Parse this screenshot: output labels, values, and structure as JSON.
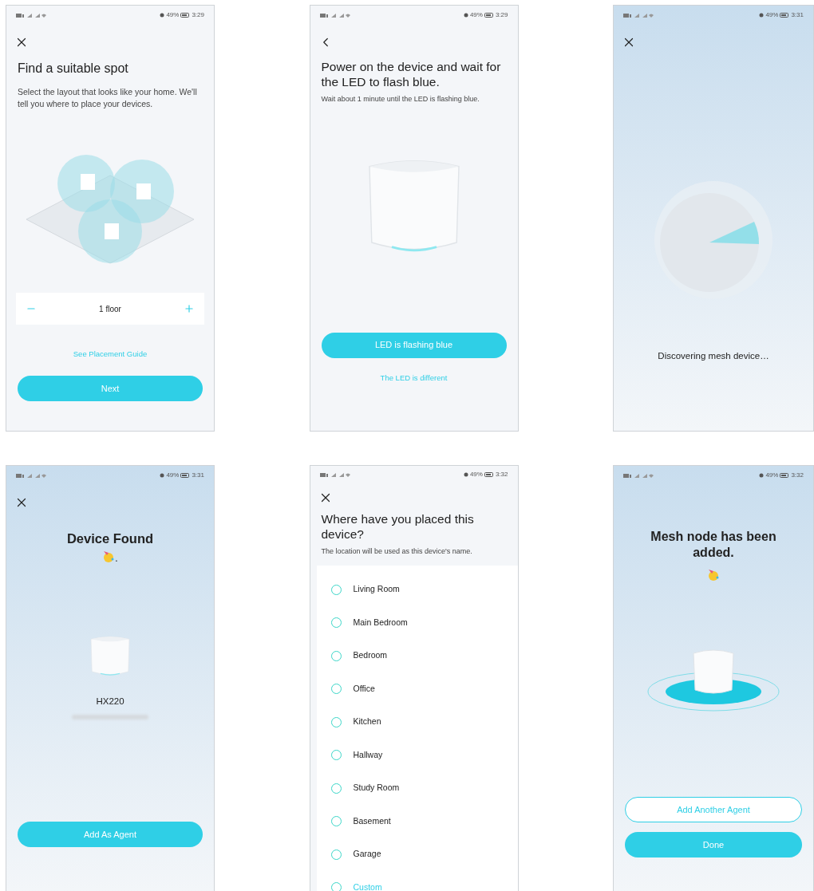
{
  "screens": [
    {
      "kind": "placement",
      "nav": {
        "kind": "close"
      },
      "status": {
        "battery": "49%",
        "time": "3:29"
      },
      "title": "Find a suitable spot",
      "subtitle": "Select the layout that looks like your home. We'll tell you where to place your devices.",
      "stepper": {
        "value": "1 floor"
      },
      "link": "See Placement Guide",
      "primary": "Next"
    },
    {
      "kind": "power",
      "nav": {
        "kind": "back"
      },
      "status": {
        "battery": "49%",
        "time": "3:29"
      },
      "title": "Power on the device and wait for the LED to flash blue.",
      "subtitle": "Wait about 1 minute until the LED is flashing blue.",
      "primary": "LED is flashing blue",
      "link": "The LED is different"
    },
    {
      "kind": "discovering",
      "nav": {
        "kind": "close"
      },
      "status": {
        "battery": "49%",
        "time": "3:31"
      },
      "message": "Discovering mesh device…"
    },
    {
      "kind": "found",
      "nav": {
        "kind": "close"
      },
      "status": {
        "battery": "49%",
        "time": "3:31"
      },
      "title": "Device Found",
      "emoji_suffix": ".",
      "model": "HX220",
      "primary": "Add As Agent"
    },
    {
      "kind": "location",
      "nav": {
        "kind": "close"
      },
      "status": {
        "battery": "49%",
        "time": "3:32"
      },
      "title": "Where have you placed this device?",
      "subtitle": "The location will be used as this device's name.",
      "options": [
        {
          "label": "Living Room",
          "kind": "preset",
          "selected": false
        },
        {
          "label": "Main Bedroom",
          "kind": "preset",
          "selected": false
        },
        {
          "label": "Bedroom",
          "kind": "preset",
          "selected": false
        },
        {
          "label": "Office",
          "kind": "preset",
          "selected": false
        },
        {
          "label": "Kitchen",
          "kind": "preset",
          "selected": false
        },
        {
          "label": "Hallway",
          "kind": "preset",
          "selected": false
        },
        {
          "label": "Study Room",
          "kind": "preset",
          "selected": false
        },
        {
          "label": "Basement",
          "kind": "preset",
          "selected": false
        },
        {
          "label": "Garage",
          "kind": "preset",
          "selected": false
        },
        {
          "label": "Custom",
          "kind": "custom",
          "selected": false
        }
      ]
    },
    {
      "kind": "added",
      "status": {
        "battery": "49%",
        "time": "3:32"
      },
      "title": "Mesh node has been added.",
      "secondary": "Add Another Agent",
      "primary": "Done"
    }
  ]
}
